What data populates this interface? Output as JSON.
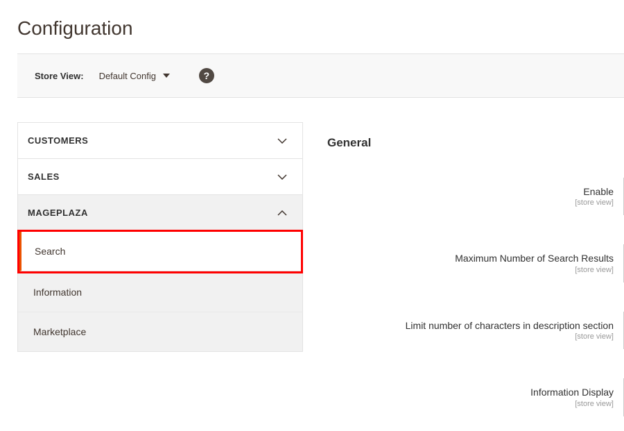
{
  "page_title": "Configuration",
  "store_view": {
    "label": "Store View:",
    "value": "Default Config",
    "help": "?"
  },
  "sidebar": {
    "sections": [
      {
        "label": "Customers",
        "expanded": false
      },
      {
        "label": "Sales",
        "expanded": false
      },
      {
        "label": "Mageplaza",
        "expanded": true,
        "items": [
          {
            "label": "Search",
            "active": true
          },
          {
            "label": "Information",
            "active": false
          },
          {
            "label": "Marketplace",
            "active": false
          }
        ]
      }
    ]
  },
  "main": {
    "section_title": "General",
    "fields": [
      {
        "label": "Enable",
        "scope": "[store view]"
      },
      {
        "label": "Maximum Number of Search Results",
        "scope": "[store view]"
      },
      {
        "label": "Limit number of characters in description section",
        "scope": "[store view]"
      },
      {
        "label": "Information Display",
        "scope": "[store view]"
      }
    ]
  }
}
